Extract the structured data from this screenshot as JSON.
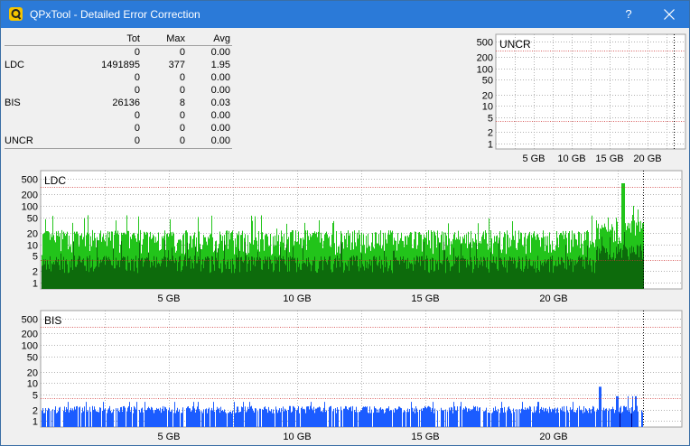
{
  "window": {
    "title": "QPxTool - Detailed Error Correction",
    "help_label": "?",
    "accent": "#2b7ad8"
  },
  "stats": {
    "headers": [
      "Tot",
      "Max",
      "Avg"
    ],
    "rows": [
      {
        "label": "",
        "tot": "0",
        "max": "0",
        "avg": "0.00"
      },
      {
        "label": "LDC",
        "tot": "1491895",
        "max": "377",
        "avg": "1.95"
      },
      {
        "label": "",
        "tot": "0",
        "max": "0",
        "avg": "0.00"
      },
      {
        "label": "",
        "tot": "0",
        "max": "0",
        "avg": "0.00"
      },
      {
        "label": "BIS",
        "tot": "26136",
        "max": "8",
        "avg": "0.03"
      },
      {
        "label": "",
        "tot": "0",
        "max": "0",
        "avg": "0.00"
      },
      {
        "label": "",
        "tot": "0",
        "max": "0",
        "avg": "0.00"
      },
      {
        "label": "UNCR",
        "tot": "0",
        "max": "0",
        "avg": "0.00"
      }
    ]
  },
  "chart_data": [
    {
      "type": "bar",
      "title": "UNCR",
      "y_scale": "log",
      "y_ticks": [
        1,
        2,
        5,
        10,
        20,
        50,
        100,
        200,
        500
      ],
      "y_tick_labels": [
        "1",
        "2",
        "5",
        "10",
        "20",
        "50",
        "100",
        "200",
        "500"
      ],
      "x_ticks": [
        5,
        10,
        15,
        20
      ],
      "x_tick_labels": [
        "5 GB",
        "10 GB",
        "15 GB",
        "20 GB"
      ],
      "xlim": [
        0,
        25
      ],
      "ylim": [
        0.7,
        800
      ],
      "x_end": 23.5,
      "red_lines": [
        4,
        300
      ],
      "grid": true,
      "series": [
        {
          "values": []
        }
      ]
    },
    {
      "type": "bar",
      "title": "LDC",
      "y_scale": "log",
      "y_ticks": [
        1,
        2,
        5,
        10,
        20,
        50,
        100,
        200,
        500
      ],
      "y_tick_labels": [
        "1",
        "2",
        "5",
        "10",
        "20",
        "50",
        "100",
        "200",
        "500"
      ],
      "x_ticks": [
        5,
        10,
        15,
        20
      ],
      "x_tick_labels": [
        "5 GB",
        "10 GB",
        "15 GB",
        "20 GB"
      ],
      "xlim": [
        0,
        25
      ],
      "ylim": [
        0.7,
        800
      ],
      "x_end": 23.5,
      "red_lines": [
        4,
        300
      ],
      "grid": true,
      "max": 377,
      "typical_peak": 15,
      "typical_base": 3,
      "colors": {
        "bright": "#22c41a",
        "dark": "#0d6b0c"
      }
    },
    {
      "type": "bar",
      "title": "BIS",
      "y_scale": "log",
      "y_ticks": [
        1,
        2,
        5,
        10,
        20,
        50,
        100,
        200,
        500
      ],
      "y_tick_labels": [
        "1",
        "2",
        "5",
        "10",
        "20",
        "50",
        "100",
        "200",
        "500"
      ],
      "x_ticks": [
        5,
        10,
        15,
        20
      ],
      "x_tick_labels": [
        "5 GB",
        "10 GB",
        "15 GB",
        "20 GB"
      ],
      "xlim": [
        0,
        25
      ],
      "ylim": [
        0.7,
        800
      ],
      "x_end": 23.5,
      "red_lines": [
        4,
        300
      ],
      "grid": true,
      "max": 8,
      "typical": 2,
      "colors": {
        "bar": "#1b5cff",
        "dark": "#000080"
      }
    }
  ]
}
